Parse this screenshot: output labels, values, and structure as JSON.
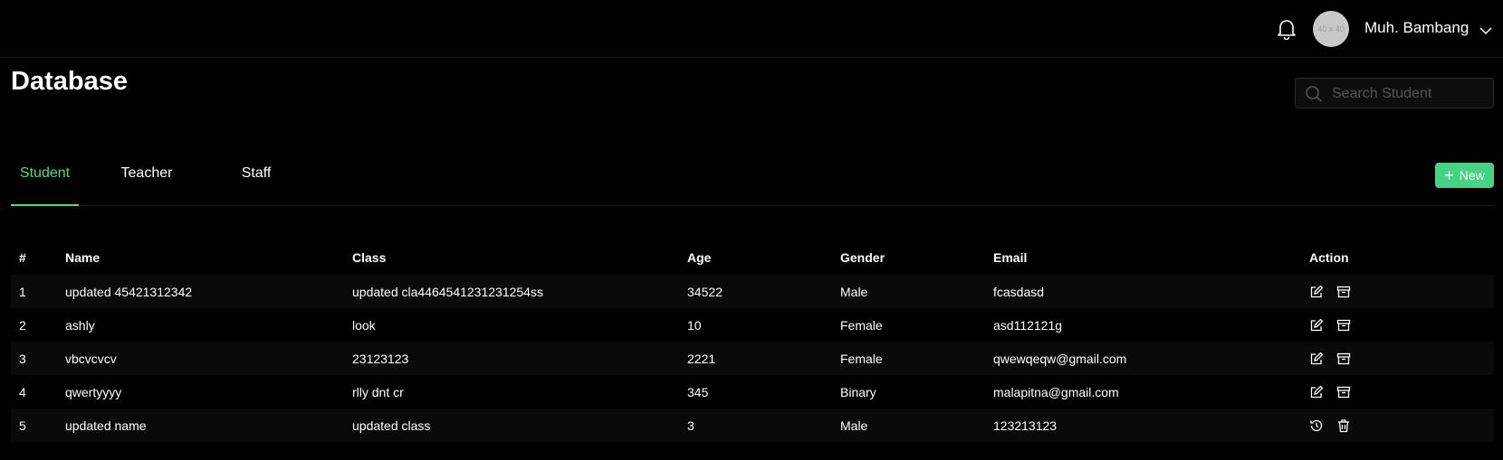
{
  "header": {
    "avatar_placeholder": "40 x 40",
    "username": "Muh. Bambang"
  },
  "page": {
    "title": "Database"
  },
  "search": {
    "placeholder": "Search Student",
    "value": ""
  },
  "tabs": [
    {
      "label": "Student",
      "active": true
    },
    {
      "label": "Teacher",
      "active": false
    },
    {
      "label": "Staff",
      "active": false
    }
  ],
  "new_button": {
    "label": "New"
  },
  "colors": {
    "accent": "#4ed98a",
    "background": "#000000"
  },
  "table": {
    "headers": [
      "#",
      "Name",
      "Class",
      "Age",
      "Gender",
      "Email",
      "Action"
    ],
    "rows": [
      {
        "no": "1",
        "name": "updated 45421312342",
        "class": "updated cla4464541231231254ss",
        "age": "34522",
        "gender": "Male",
        "email": "fcasdasd",
        "actions": [
          "edit-icon",
          "archive-icon"
        ]
      },
      {
        "no": "2",
        "name": "ashly",
        "class": "look",
        "age": "10",
        "gender": "Female",
        "email": "asd112121g",
        "actions": [
          "edit-icon",
          "archive-icon"
        ]
      },
      {
        "no": "3",
        "name": "vbcvcvcv",
        "class": "23123123",
        "age": "2221",
        "gender": "Female",
        "email": "qwewqeqw@gmail.com",
        "actions": [
          "edit-icon",
          "archive-icon"
        ]
      },
      {
        "no": "4",
        "name": "qwertyyyy",
        "class": "rlly dnt cr",
        "age": "345",
        "gender": "Binary",
        "email": "malapitna@gmail.com",
        "actions": [
          "edit-icon",
          "archive-icon"
        ]
      },
      {
        "no": "5",
        "name": "updated name",
        "class": "updated class",
        "age": "3",
        "gender": "Male",
        "email": "123213123",
        "actions": [
          "restore-icon",
          "trash-icon"
        ]
      }
    ]
  }
}
